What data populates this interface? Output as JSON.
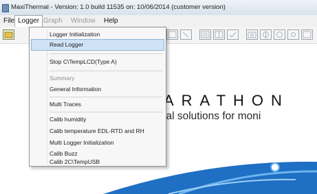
{
  "window": {
    "title": "MaxiThermal - Version: 1.0 build 11535 on: 10/06/2014 (customer version)"
  },
  "menubar": {
    "file": "File",
    "logger": "Logger",
    "graph": "Graph",
    "window": "Window",
    "help": "Help"
  },
  "logger_menu": {
    "items": [
      {
        "label": "Logger Initialization",
        "enabled": true
      },
      {
        "label": "Read Logger",
        "enabled": true,
        "highlighted": true
      },
      {
        "label": "Stop C\\TempLCD(Type A)",
        "enabled": true
      },
      {
        "label": "Summary",
        "enabled": false
      },
      {
        "label": "General Information",
        "enabled": true
      },
      {
        "label": "Multi Traces",
        "enabled": true
      },
      {
        "label": "Calib humidity",
        "enabled": true
      },
      {
        "label": "Calib temperature EDL-RTD and RH",
        "enabled": true
      },
      {
        "label": "Multi Logger Initialization",
        "enabled": true
      },
      {
        "label": "Calib Buzz",
        "enabled": true
      },
      {
        "label": "Calib 2C\\TempUSB",
        "enabled": true
      }
    ]
  },
  "content": {
    "brand": "ARATHON",
    "tagline": "tical solutions for moni"
  },
  "colors": {
    "highlight": "#cfe3f6",
    "swoosh_blue": "#1f6fc4"
  }
}
